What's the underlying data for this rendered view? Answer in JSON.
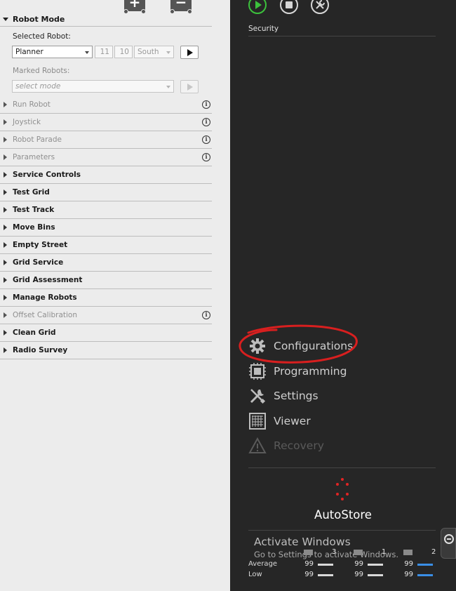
{
  "left": {
    "robot_mode": {
      "header": "Robot Mode",
      "selected_robot_label": "Selected Robot:",
      "robot_select_value": "Planner",
      "x_value": "11",
      "y_value": "10",
      "direction_value": "South",
      "marked_robots_label": "Marked Robots:",
      "marked_select_placeholder": "select mode"
    },
    "menu_items": [
      {
        "label": "Run Robot",
        "enabled": false,
        "info": true
      },
      {
        "label": "Joystick",
        "enabled": false,
        "info": true
      },
      {
        "label": "Robot Parade",
        "enabled": false,
        "info": true
      },
      {
        "label": "Parameters",
        "enabled": false,
        "info": true
      },
      {
        "label": "Service Controls",
        "enabled": true,
        "info": false
      },
      {
        "label": "Test Grid",
        "enabled": true,
        "info": false
      },
      {
        "label": "Test Track",
        "enabled": true,
        "info": false
      },
      {
        "label": "Move Bins",
        "enabled": true,
        "info": false
      },
      {
        "label": "Empty Street",
        "enabled": true,
        "info": false
      },
      {
        "label": "Grid Service",
        "enabled": true,
        "info": false
      },
      {
        "label": "Grid Assessment",
        "enabled": true,
        "info": false
      },
      {
        "label": "Manage Robots",
        "enabled": true,
        "info": false
      },
      {
        "label": "Offset Calibration",
        "enabled": false,
        "info": true
      },
      {
        "label": "Clean Grid",
        "enabled": true,
        "info": false
      },
      {
        "label": "Radio Survey",
        "enabled": true,
        "info": false
      }
    ],
    "info_glyph": "i"
  },
  "right": {
    "section_title": "Security",
    "nav": [
      {
        "label": "Configurations",
        "icon": "gear-icon",
        "enabled": true
      },
      {
        "label": "Programming",
        "icon": "chip-icon",
        "enabled": true
      },
      {
        "label": "Settings",
        "icon": "wrench-screwdriver-icon",
        "enabled": true
      },
      {
        "label": "Viewer",
        "icon": "grid-viewer-icon",
        "enabled": true
      },
      {
        "label": "Recovery",
        "icon": "warning-icon",
        "enabled": false
      }
    ],
    "brand": "AutoStore",
    "brand_accent": "#e02424",
    "run_color": "#3cc13c",
    "watermark": {
      "title": "Activate Windows",
      "subtitle": "Go to Settings to activate Windows."
    },
    "robot_counts": [
      "3",
      "1",
      "2"
    ],
    "stats": {
      "average_label": "Average",
      "low_label": "Low",
      "average_values": [
        "99",
        "99",
        "99"
      ],
      "low_values": [
        "99",
        "99",
        "99"
      ],
      "bar_colors": [
        "#d9d9d9",
        "#d9d9d9",
        "#3a8ee6"
      ]
    },
    "annotation_color": "#d81f1f"
  }
}
